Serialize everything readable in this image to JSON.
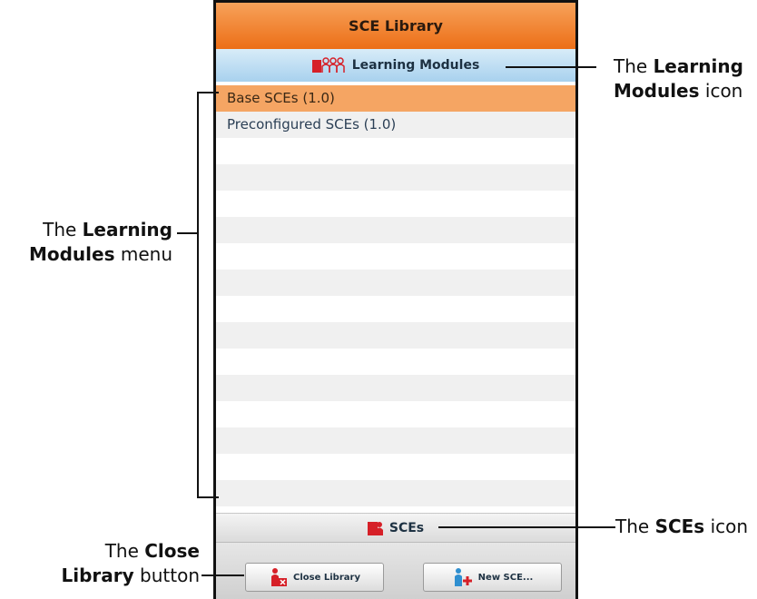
{
  "panel": {
    "title": "SCE Library",
    "learning_modules_bar": {
      "label": "Learning Modules",
      "icon": "learning-modules-icon"
    },
    "list_items": [
      {
        "label": "Base SCEs (1.0)",
        "selected": true
      },
      {
        "label": "Preconfigured SCEs (1.0)",
        "selected": false
      }
    ],
    "sces_bar": {
      "label": "SCEs",
      "icon": "sces-icon"
    },
    "buttons": {
      "close_library": "Close Library",
      "new_sce": "New SCE..."
    }
  },
  "annotations": {
    "lm_icon": {
      "pre": "The ",
      "bold1": "Learning",
      "bold2": "Modules",
      "post": " icon"
    },
    "lm_menu": {
      "pre": "The ",
      "bold1": "Learning",
      "bold2": "Modules",
      "post": " menu"
    },
    "sces_icon": {
      "pre": "The ",
      "bold": "SCEs",
      "post": " icon"
    },
    "close_button": {
      "pre": "The ",
      "bold1": "Close",
      "bold2": "Library",
      "post": " button"
    }
  },
  "colors": {
    "header": "#ec6f17",
    "selected_row": "#f5a563",
    "lm_bar": "#a8d1ee",
    "icon_red": "#d62028"
  }
}
